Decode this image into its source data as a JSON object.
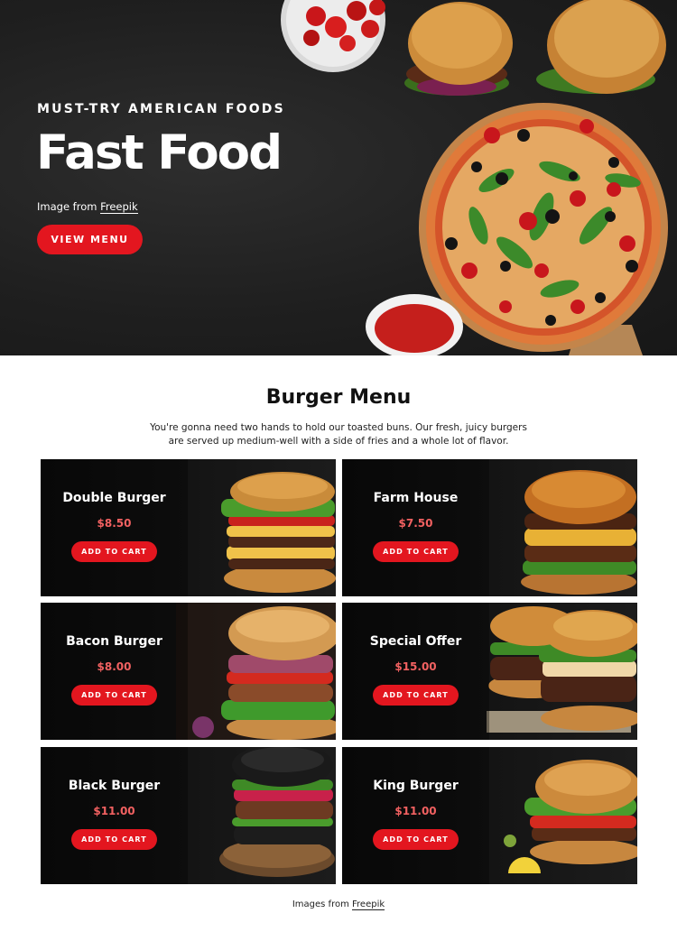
{
  "hero": {
    "eyebrow": "MUST-TRY AMERICAN FOODS",
    "title": "Fast Food",
    "credit_prefix": "Image from ",
    "credit_link": "Freepik",
    "cta_label": "VIEW MENU"
  },
  "menu": {
    "title": "Burger Menu",
    "description": "You're gonna need two hands to hold our toasted buns. Our fresh, juicy burgers are served up medium-well with a side of fries and a whole lot of flavor.",
    "items": [
      {
        "name": "Double Burger",
        "price": "$8.50",
        "cart_label": "ADD TO CART"
      },
      {
        "name": "Farm House",
        "price": "$7.50",
        "cart_label": "ADD TO CART"
      },
      {
        "name": "Bacon Burger",
        "price": "$8.00",
        "cart_label": "ADD TO CART"
      },
      {
        "name": "Special Offer",
        "price": "$15.00",
        "cart_label": "ADD TO CART"
      },
      {
        "name": "Black Burger",
        "price": "$11.00",
        "cart_label": "ADD TO CART"
      },
      {
        "name": "King Burger",
        "price": "$11.00",
        "cart_label": "ADD TO CART"
      }
    ]
  },
  "footer": {
    "credit_prefix": "Images from ",
    "credit_link": "Freepik"
  },
  "colors": {
    "accent": "#e3161f",
    "price": "#f26161",
    "hero_bg": "#1f1f1f"
  }
}
